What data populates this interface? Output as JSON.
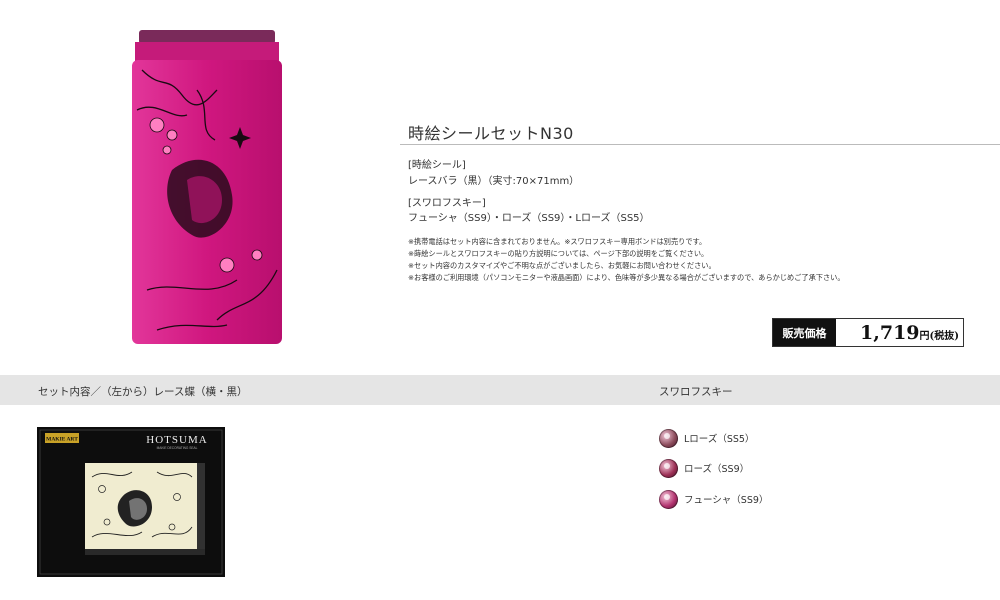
{
  "product": {
    "title": "時絵シールセットN30",
    "seal_heading": "[時絵シール]",
    "seal_detail": "レースバラ（黒）（実寸:70×71mm）",
    "swarovski_heading": "[スワロフスキー]",
    "swarovski_detail": "フューシャ（SS9）・ローズ（SS9）・Lローズ（SS5）",
    "notes": [
      "※携帯電話はセット内容に含まれておりません。※スワロフスキー専用ボンドは別売りです。",
      "※蒔絵シールとスワロフスキーの貼り方説明については、ページ下部の説明をご覧ください。",
      "※セット内容のカスタマイズやご不明な点がございましたら、お気軽にお問い合わせください。",
      "※お客様のご利用環境（パソコンモニターや液晶画面）により、色味等が多少異なる場合がございますので、あらかじめご了承下さい。"
    ]
  },
  "price": {
    "label": "販売価格",
    "value": "1,719",
    "unit": "円(税抜)"
  },
  "band": {
    "left_label": "セット内容／（左から）レース蝶（横・黒）",
    "right_label": "スワロフスキー"
  },
  "card": {
    "badge": "MAKIE ART",
    "brand": "HOTSUMA",
    "brand_sub": "MAKIE DECORATING SEAL"
  },
  "swarovski": [
    {
      "name": "Lローズ（SS5）",
      "color": "#8a4a5a"
    },
    {
      "name": "ローズ（SS9）",
      "color": "#9c2f55"
    },
    {
      "name": "フューシャ（SS9）",
      "color": "#b1316e"
    }
  ],
  "colors": {
    "phone_pink": "#d0177f",
    "phone_top": "#7a2a5a",
    "band": "#e5e5e5",
    "card_bg": "#0d0d0d",
    "sticker_bg": "#f0ecd0"
  }
}
